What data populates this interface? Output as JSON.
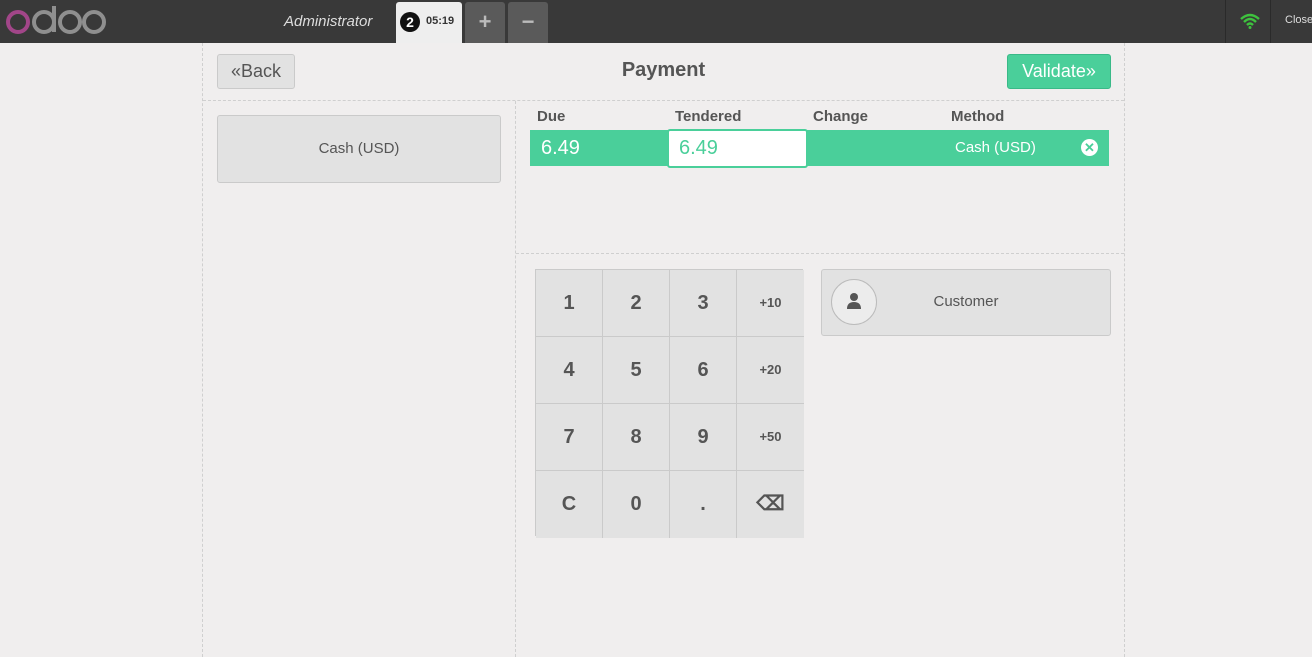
{
  "topbar": {
    "logo": "odoo",
    "cashier": "Administrator",
    "order": {
      "number": "2",
      "time": "05:19"
    },
    "add_order_label": "+",
    "remove_order_label": "−",
    "close_label": "Close"
  },
  "header": {
    "back_label": "Back",
    "title": "Payment",
    "validate_label": "Validate"
  },
  "payment_methods": [
    {
      "label": "Cash (USD)"
    }
  ],
  "paymentlines": {
    "columns": [
      "Due",
      "Tendered",
      "Change",
      "Method"
    ],
    "rows": [
      {
        "due": "6.49",
        "tendered": "6.49",
        "change": "",
        "method": "Cash (USD)"
      }
    ]
  },
  "numpad": {
    "keys": [
      "1",
      "2",
      "3",
      "+10",
      "4",
      "5",
      "6",
      "+20",
      "7",
      "8",
      "9",
      "+50",
      "C",
      "0",
      ".",
      "⌫"
    ]
  },
  "customer": {
    "label": "Customer"
  },
  "colors": {
    "accent": "#4acf9a",
    "topbar": "#393939",
    "logo_purple": "#a24689"
  }
}
